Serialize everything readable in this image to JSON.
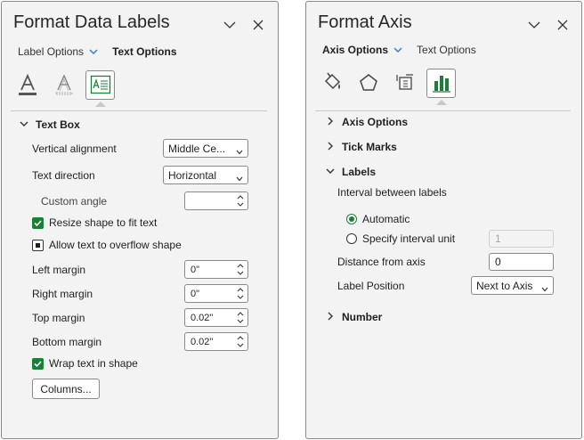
{
  "colors": {
    "accent": "#1a7f37",
    "tab_arrow": "#3c78d8",
    "border": "#8a8a8a",
    "pane_bg": "#f3f3f3"
  },
  "left_pane": {
    "title": "Format Data Labels",
    "tabs": [
      {
        "label": "Label Options",
        "active": false
      },
      {
        "label": "Text Options",
        "active": true
      }
    ],
    "icons": [
      "text-fill-icon",
      "text-outline-icon",
      "text-box-icon"
    ],
    "section": "Text Box",
    "vertical_alignment": {
      "label": "Vertical alignment",
      "value": "Middle Ce..."
    },
    "text_direction": {
      "label": "Text direction",
      "value": "Horizontal"
    },
    "custom_angle": {
      "label": "Custom angle",
      "value": ""
    },
    "resize_shape": {
      "label": "Resize shape to fit text",
      "checked": true
    },
    "allow_overflow": {
      "label": "Allow text to overflow shape",
      "checked": "partial"
    },
    "left_margin": {
      "label": "Left margin",
      "value": "0\""
    },
    "right_margin": {
      "label": "Right margin",
      "value": "0\""
    },
    "top_margin": {
      "label": "Top margin",
      "value": "0.02\""
    },
    "bottom_margin": {
      "label": "Bottom margin",
      "value": "0.02\""
    },
    "wrap_text": {
      "label": "Wrap text in shape",
      "checked": true
    },
    "columns_button": "Columns..."
  },
  "right_pane": {
    "title": "Format Axis",
    "tabs": [
      {
        "label": "Axis Options",
        "active": true
      },
      {
        "label": "Text Options",
        "active": false
      }
    ],
    "icons": [
      "fill-line-icon",
      "effects-icon",
      "size-properties-icon",
      "axis-options-icon"
    ],
    "sections": {
      "axis_options": "Axis Options",
      "tick_marks": "Tick Marks",
      "labels": "Labels",
      "number": "Number"
    },
    "interval_label": "Interval between labels",
    "automatic": "Automatic",
    "specify_interval": "Specify interval unit",
    "interval_value": "1",
    "distance_label": "Distance from axis",
    "distance_value": "0",
    "label_position_label": "Label Position",
    "label_position_value": "Next to Axis"
  }
}
